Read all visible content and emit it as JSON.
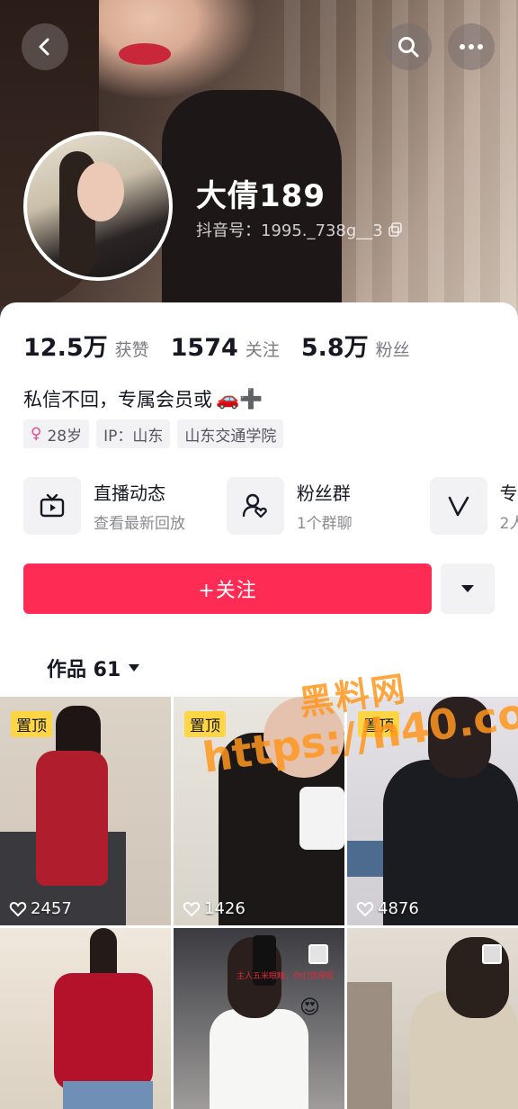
{
  "profile": {
    "name": "大倩189",
    "douyin_id": "抖音号：1995._738g__3"
  },
  "stats": [
    {
      "num": "12.5万",
      "label": "获赞"
    },
    {
      "num": "1574",
      "label": "关注"
    },
    {
      "num": "5.8万",
      "label": "粉丝"
    }
  ],
  "bio": {
    "text": "私信不回，专属会员或",
    "emoji": "🚗➕"
  },
  "tags": {
    "age": "28岁",
    "ip": "IP：山东",
    "school": "山东交通学院"
  },
  "features": [
    {
      "title": "直播动态",
      "subtitle": "查看最新回放",
      "icon": "tv-icon"
    },
    {
      "title": "粉丝群",
      "subtitle": "1个群聊",
      "icon": "fans-group-icon"
    },
    {
      "title": "专",
      "subtitle": "2人",
      "icon": "v-icon"
    }
  ],
  "actions": {
    "follow_label": "+关注"
  },
  "works": {
    "tab_label": "作品 61"
  },
  "grid": [
    {
      "pinned": "置顶",
      "likes": "2457"
    },
    {
      "pinned": "置顶",
      "likes": "1426"
    },
    {
      "pinned": "置顶",
      "likes": "4876"
    },
    {
      "multi": true
    },
    {
      "multi": true,
      "caption": "主人五米眼睛，你们觉得呢"
    },
    {
      "multi": true
    }
  ],
  "watermark": {
    "line1": "黑料网",
    "line2": "https://h40.co"
  },
  "colors": {
    "accent": "#fe2c55",
    "pin": "#fdd545"
  }
}
